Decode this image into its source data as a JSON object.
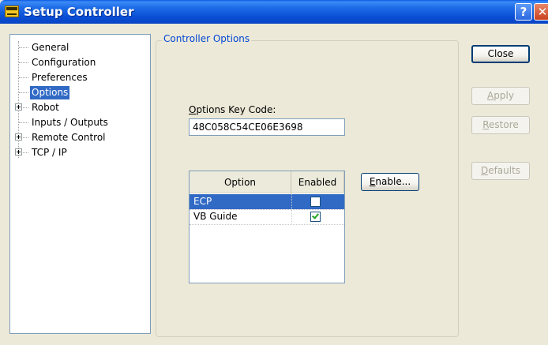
{
  "window": {
    "title": "Setup Controller",
    "help_glyph": "?",
    "close_glyph": "✕"
  },
  "tree": {
    "items": [
      {
        "label": "General",
        "expandable": false,
        "selected": false
      },
      {
        "label": "Configuration",
        "expandable": false,
        "selected": false
      },
      {
        "label": "Preferences",
        "expandable": false,
        "selected": false
      },
      {
        "label": "Options",
        "expandable": false,
        "selected": true
      },
      {
        "label": "Robot",
        "expandable": true,
        "selected": false
      },
      {
        "label": "Inputs / Outputs",
        "expandable": false,
        "selected": false
      },
      {
        "label": "Remote Control",
        "expandable": true,
        "selected": false
      },
      {
        "label": "TCP / IP",
        "expandable": true,
        "selected": false
      }
    ]
  },
  "options_panel": {
    "group_title": "Controller Options",
    "key_code_label_mnemonic": "O",
    "key_code_label_rest": "ptions Key Code:",
    "key_code_value": "48C058C54CE06E3698",
    "list": {
      "columns": [
        "Option",
        "Enabled"
      ],
      "rows": [
        {
          "option": "ECP",
          "enabled": false,
          "selected": true
        },
        {
          "option": "VB Guide",
          "enabled": true,
          "selected": false
        }
      ]
    },
    "enable_button": {
      "mnemonic": "E",
      "rest": "nable..."
    }
  },
  "buttons": {
    "close": "Close",
    "apply": {
      "mnemonic": "A",
      "rest": "pply"
    },
    "restore": {
      "mnemonic": "R",
      "rest": "estore"
    },
    "defaults": {
      "mnemonic": "D",
      "rest": "efaults"
    }
  },
  "colors": {
    "selection": "#316ac5",
    "group_title": "#0046d5",
    "checkmark": "#21a121"
  }
}
